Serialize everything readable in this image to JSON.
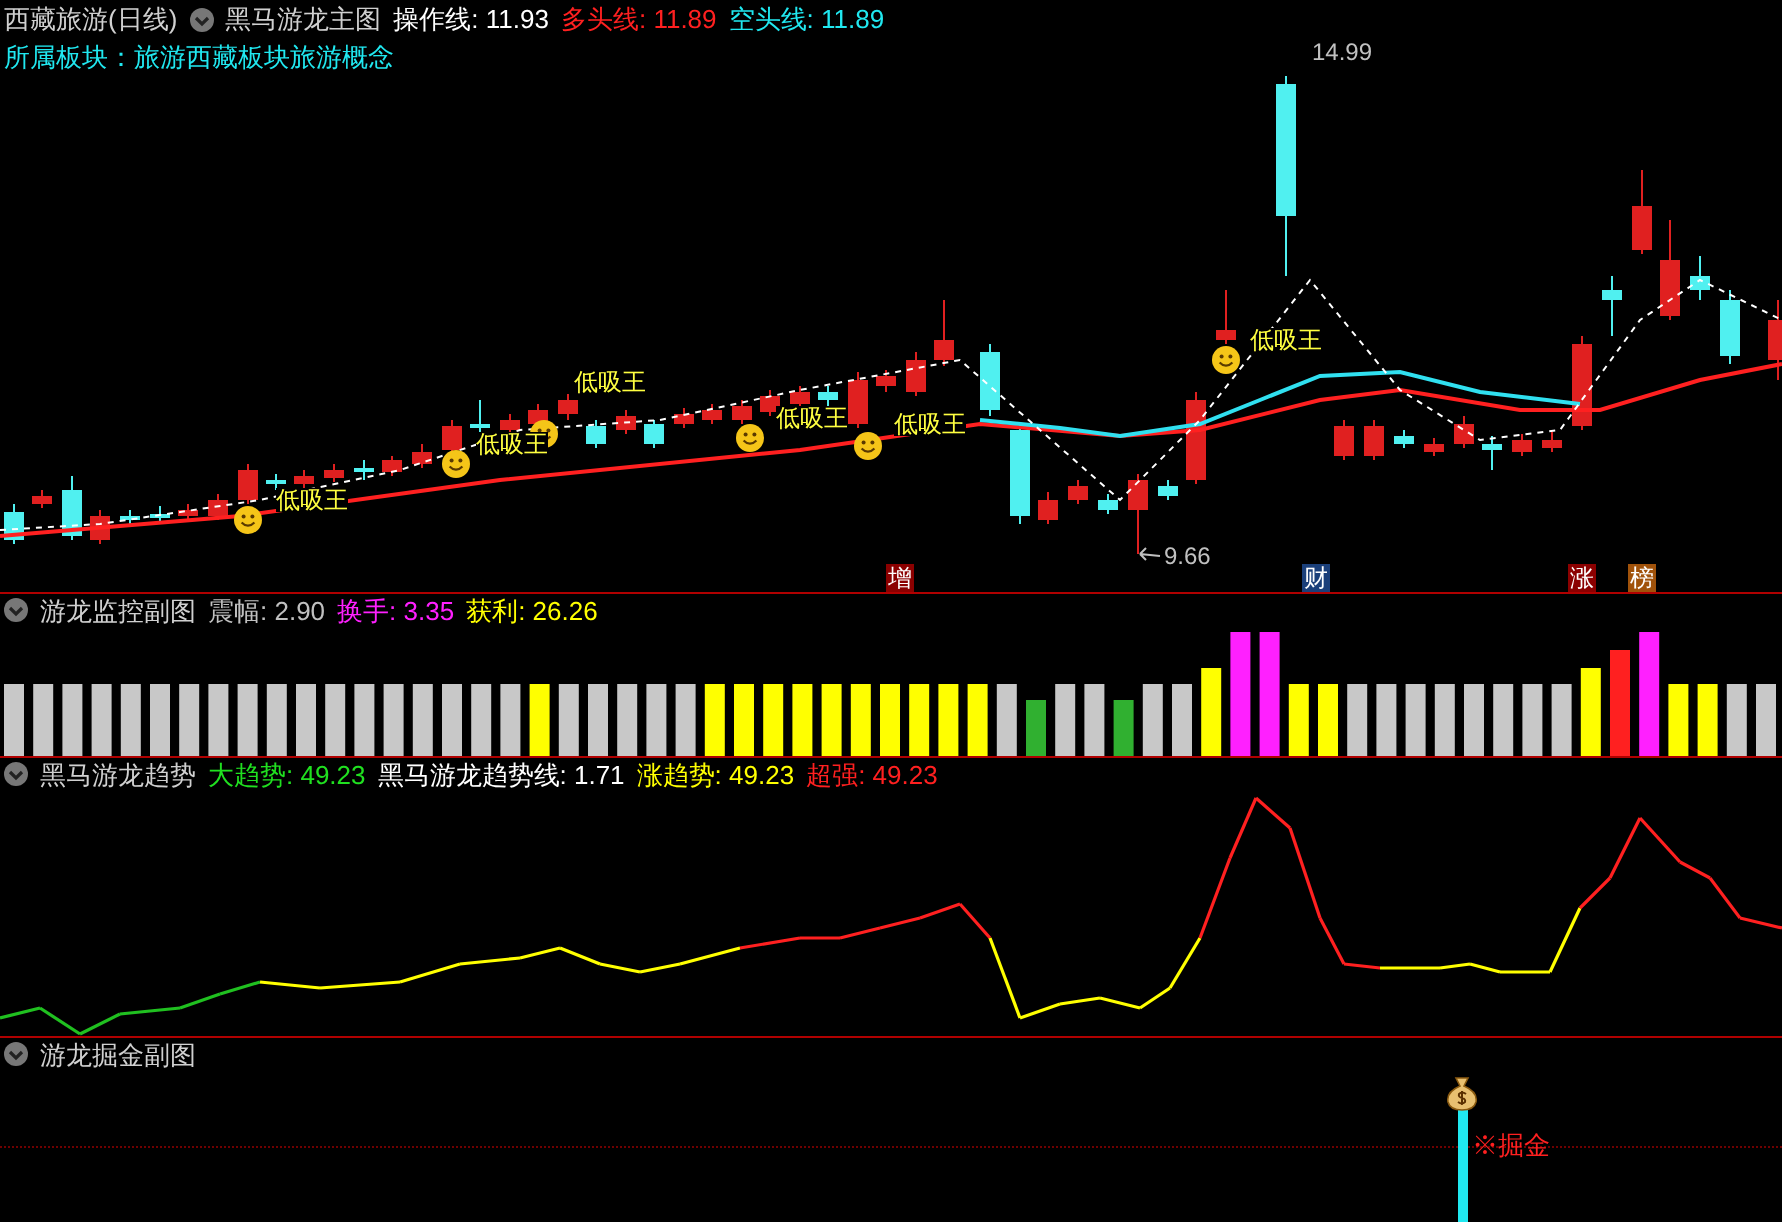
{
  "header": {
    "stock": "西藏旅游(日线)",
    "indicator": "黑马游龙主图",
    "values": [
      {
        "text": "操作线: 11.93",
        "color": "#ffffff"
      },
      {
        "text": "多头线: 11.89",
        "color": "#ff2020"
      },
      {
        "text": "空头线: 11.89",
        "color": "#20e8f0"
      }
    ]
  },
  "sector": "所属板块：旅游西藏板块旅游概念",
  "main_chart": {
    "signals": [
      "低吸王",
      "低吸王",
      "低吸王",
      "低吸王",
      "低吸王",
      "低吸王"
    ],
    "price_labels": [
      "14.99",
      "9.66"
    ],
    "event_tags": [
      {
        "text": "增",
        "color": "#8b0000"
      },
      {
        "text": "财",
        "color": "#1a3f7a"
      },
      {
        "text": "涨",
        "color": "#8b0000"
      },
      {
        "text": "榜",
        "color": "#a0520a"
      }
    ]
  },
  "monitor_panel": {
    "title": "游龙监控副图",
    "values": [
      {
        "text": "震幅: 2.90",
        "color": "#c0c0c0"
      },
      {
        "text": "换手: 3.35",
        "color": "#ff20ff"
      },
      {
        "text": "获利: 26.26",
        "color": "#ffff00"
      }
    ]
  },
  "trend_panel": {
    "title": "黑马游龙趋势",
    "values": [
      {
        "text": "大趋势: 49.23",
        "color": "#20e020"
      },
      {
        "text": "黑马游龙趋势线: 1.71",
        "color": "#ffffff"
      },
      {
        "text": "涨趋势: 49.23",
        "color": "#ffff00"
      },
      {
        "text": "超强: 49.23",
        "color": "#ff2020"
      }
    ]
  },
  "gold_panel": {
    "title": "游龙掘金副图",
    "signal": "※掘金"
  }
}
